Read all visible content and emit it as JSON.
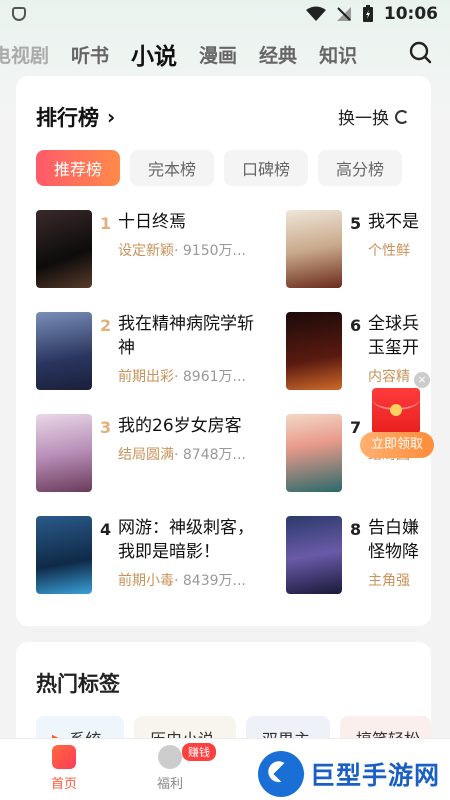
{
  "status_bar": {
    "time": "10:06"
  },
  "top_nav": {
    "tabs": [
      {
        "label": "电视剧"
      },
      {
        "label": "听书"
      },
      {
        "label": "小说"
      },
      {
        "label": "漫画"
      },
      {
        "label": "经典"
      },
      {
        "label": "知识"
      }
    ],
    "active_tab": "小说",
    "search_icon": "search-icon"
  },
  "ranking": {
    "title": "排行榜",
    "swap_label": "换一换",
    "chips": [
      {
        "label": "推荐榜"
      },
      {
        "label": "完本榜"
      },
      {
        "label": "口碑榜"
      },
      {
        "label": "高分榜"
      }
    ],
    "books": [
      {
        "rank": "1",
        "title": "十日终焉",
        "tag": "设定新颖",
        "count": "· 9150万..."
      },
      {
        "rank": "2",
        "title": "我在精神病院学斩神",
        "tag": "前期出彩",
        "count": "· 8961万..."
      },
      {
        "rank": "3",
        "title": "我的26岁女房客",
        "tag": "结局圆满",
        "count": "· 8748万..."
      },
      {
        "rank": "4",
        "title": "网游：神级刺客，我即是暗影！",
        "tag": "前期小毒",
        "count": "· 8439万..."
      },
      {
        "rank": "5",
        "title": "我不是",
        "tag": "个性鲜"
      },
      {
        "rank": "6",
        "title": "全球兵玉玺开",
        "tag": "内容精"
      },
      {
        "rank": "7",
        "title": "",
        "tag": "结局圆"
      },
      {
        "rank": "8",
        "title": "告白嫌怪物降",
        "tag": "主角强"
      }
    ]
  },
  "red_packet": {
    "button_label": "立即领取",
    "close_label": "×"
  },
  "hot_tags": {
    "title": "热门标签",
    "tags": [
      {
        "label": "系统"
      },
      {
        "label": "历史小说"
      },
      {
        "label": "双男主"
      },
      {
        "label": "搞笑轻松"
      }
    ]
  },
  "tab_bar": {
    "items": [
      {
        "label": "首页"
      },
      {
        "label": "福利"
      }
    ],
    "badge": "赚钱"
  },
  "watermark": {
    "text": "巨型手游网"
  },
  "colors": {
    "accent_gradient_start": "#ff5a6a",
    "accent_gradient_end": "#ff8a4a",
    "rank_highlight": "#e2b07a",
    "tag_color": "#c9925a",
    "watermark_blue": "#1a5fc4"
  }
}
